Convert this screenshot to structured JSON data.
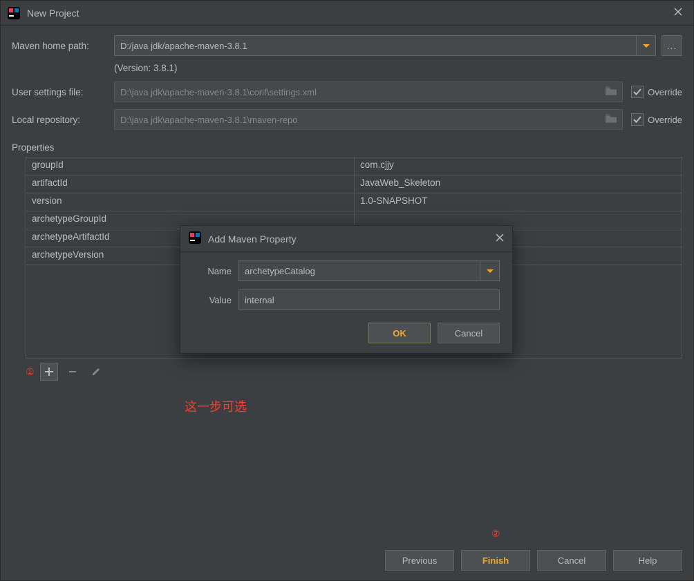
{
  "window": {
    "title": "New Project"
  },
  "form": {
    "maven_home_label": "Maven home path:",
    "maven_home_value": "D:/java jdk/apache-maven-3.8.1",
    "version_text": "(Version: 3.8.1)",
    "user_settings_label": "User settings file:",
    "user_settings_value": "D:\\java jdk\\apache-maven-3.8.1\\conf\\settings.xml",
    "local_repo_label": "Local repository:",
    "local_repo_value": "D:\\java jdk\\apache-maven-3.8.1\\maven-repo",
    "override_label": "Override",
    "browse_label": "..."
  },
  "props": {
    "label": "Properties",
    "rows": [
      {
        "key": "groupId",
        "value": "com.cjjy"
      },
      {
        "key": "artifactId",
        "value": "JavaWeb_Skeleton"
      },
      {
        "key": "version",
        "value": "1.0-SNAPSHOT"
      },
      {
        "key": "archetypeGroupId",
        "value": ""
      },
      {
        "key": "archetypeArtifactId",
        "value": ""
      },
      {
        "key": "archetypeVersion",
        "value": ""
      }
    ]
  },
  "annotations": {
    "one": "①",
    "two": "②",
    "note": "这一步可选"
  },
  "footer": {
    "previous": "Previous",
    "finish": "Finish",
    "cancel": "Cancel",
    "help": "Help"
  },
  "dialog": {
    "title": "Add Maven Property",
    "name_label": "Name",
    "name_value": "archetypeCatalog",
    "value_label": "Value",
    "value_value": "internal",
    "ok": "OK",
    "cancel": "Cancel"
  }
}
